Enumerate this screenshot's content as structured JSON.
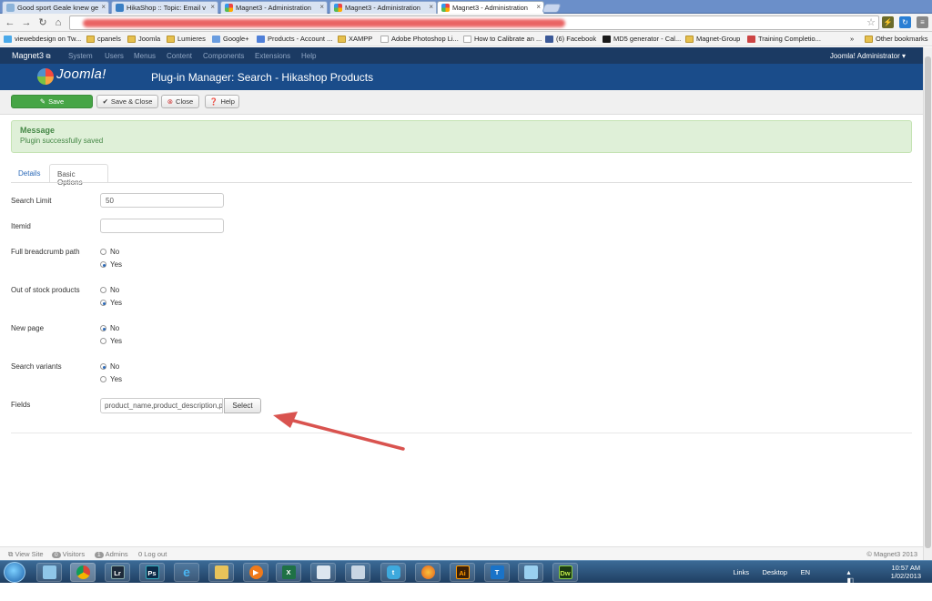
{
  "browser": {
    "tabs": [
      {
        "label": "Good sport Geale knew ge",
        "active": false
      },
      {
        "label": "HikaShop :: Topic: Email v",
        "active": false
      },
      {
        "label": "Magnet3 - Administration",
        "active": false
      },
      {
        "label": "Magnet3 - Administration",
        "active": false
      },
      {
        "label": "Magnet3 - Administration",
        "active": true
      }
    ],
    "tab_close_glyph": "×",
    "bookmarks": [
      "viewebdesign on Tw...",
      "cpanels",
      "Joomla",
      "Lumieres",
      "Google+",
      "Products - Account ...",
      "XAMPP",
      "Adobe Photoshop Li...",
      "How to Calibrate an ...",
      "(6) Facebook",
      "MD5 generator - Cal...",
      "Magnet-Group",
      "Training Completio..."
    ],
    "bookmarks_more": "»",
    "other_bookmarks": "Other bookmarks"
  },
  "joomla": {
    "site_name": "Magnet3",
    "menu": [
      "System",
      "Users",
      "Menus",
      "Content",
      "Components",
      "Extensions",
      "Help"
    ],
    "user_menu": "Joomla! Administrator",
    "logo_text": "Joomla!",
    "page_title": "Plug-in Manager: Search - Hikashop Products"
  },
  "toolbar": {
    "save": "Save",
    "save_close": "Save & Close",
    "close": "Close",
    "help": "Help"
  },
  "message": {
    "heading": "Message",
    "text": "Plugin successfully saved"
  },
  "tabs": {
    "details": "Details",
    "basic_options": "Basic Options"
  },
  "form": {
    "search_limit": {
      "label": "Search Limit",
      "value": "50"
    },
    "itemid": {
      "label": "Itemid",
      "value": ""
    },
    "full_breadcrumb": {
      "label": "Full breadcrumb path",
      "no": "No",
      "yes": "Yes",
      "selected": "Yes"
    },
    "out_of_stock": {
      "label": "Out of stock products",
      "no": "No",
      "yes": "Yes",
      "selected": "Yes"
    },
    "new_page": {
      "label": "New page",
      "no": "No",
      "yes": "Yes",
      "selected": "No"
    },
    "search_variants": {
      "label": "Search variants",
      "no": "No",
      "yes": "Yes",
      "selected": "No"
    },
    "fields": {
      "label": "Fields",
      "value": "product_name,product_description,p",
      "select_label": "Select"
    }
  },
  "footer": {
    "view_site": "View Site",
    "visitors_count": "0",
    "visitors_label": "Visitors",
    "admins_count": "1",
    "admins_label": "Admins",
    "logout_count": "0",
    "logout_label": "Log out",
    "copyright": "© Magnet3 2013"
  },
  "taskbar": {
    "links": "Links",
    "desktop": "Desktop",
    "lang": "EN",
    "time": "10:57 AM",
    "date": "1/02/2013"
  },
  "colors": {
    "joomla_nav": "#1b3a63",
    "joomla_header": "#1a4c8a",
    "save_green": "#46a546",
    "message_bg": "#dff0d8",
    "annotation_arrow": "#d9534f"
  }
}
